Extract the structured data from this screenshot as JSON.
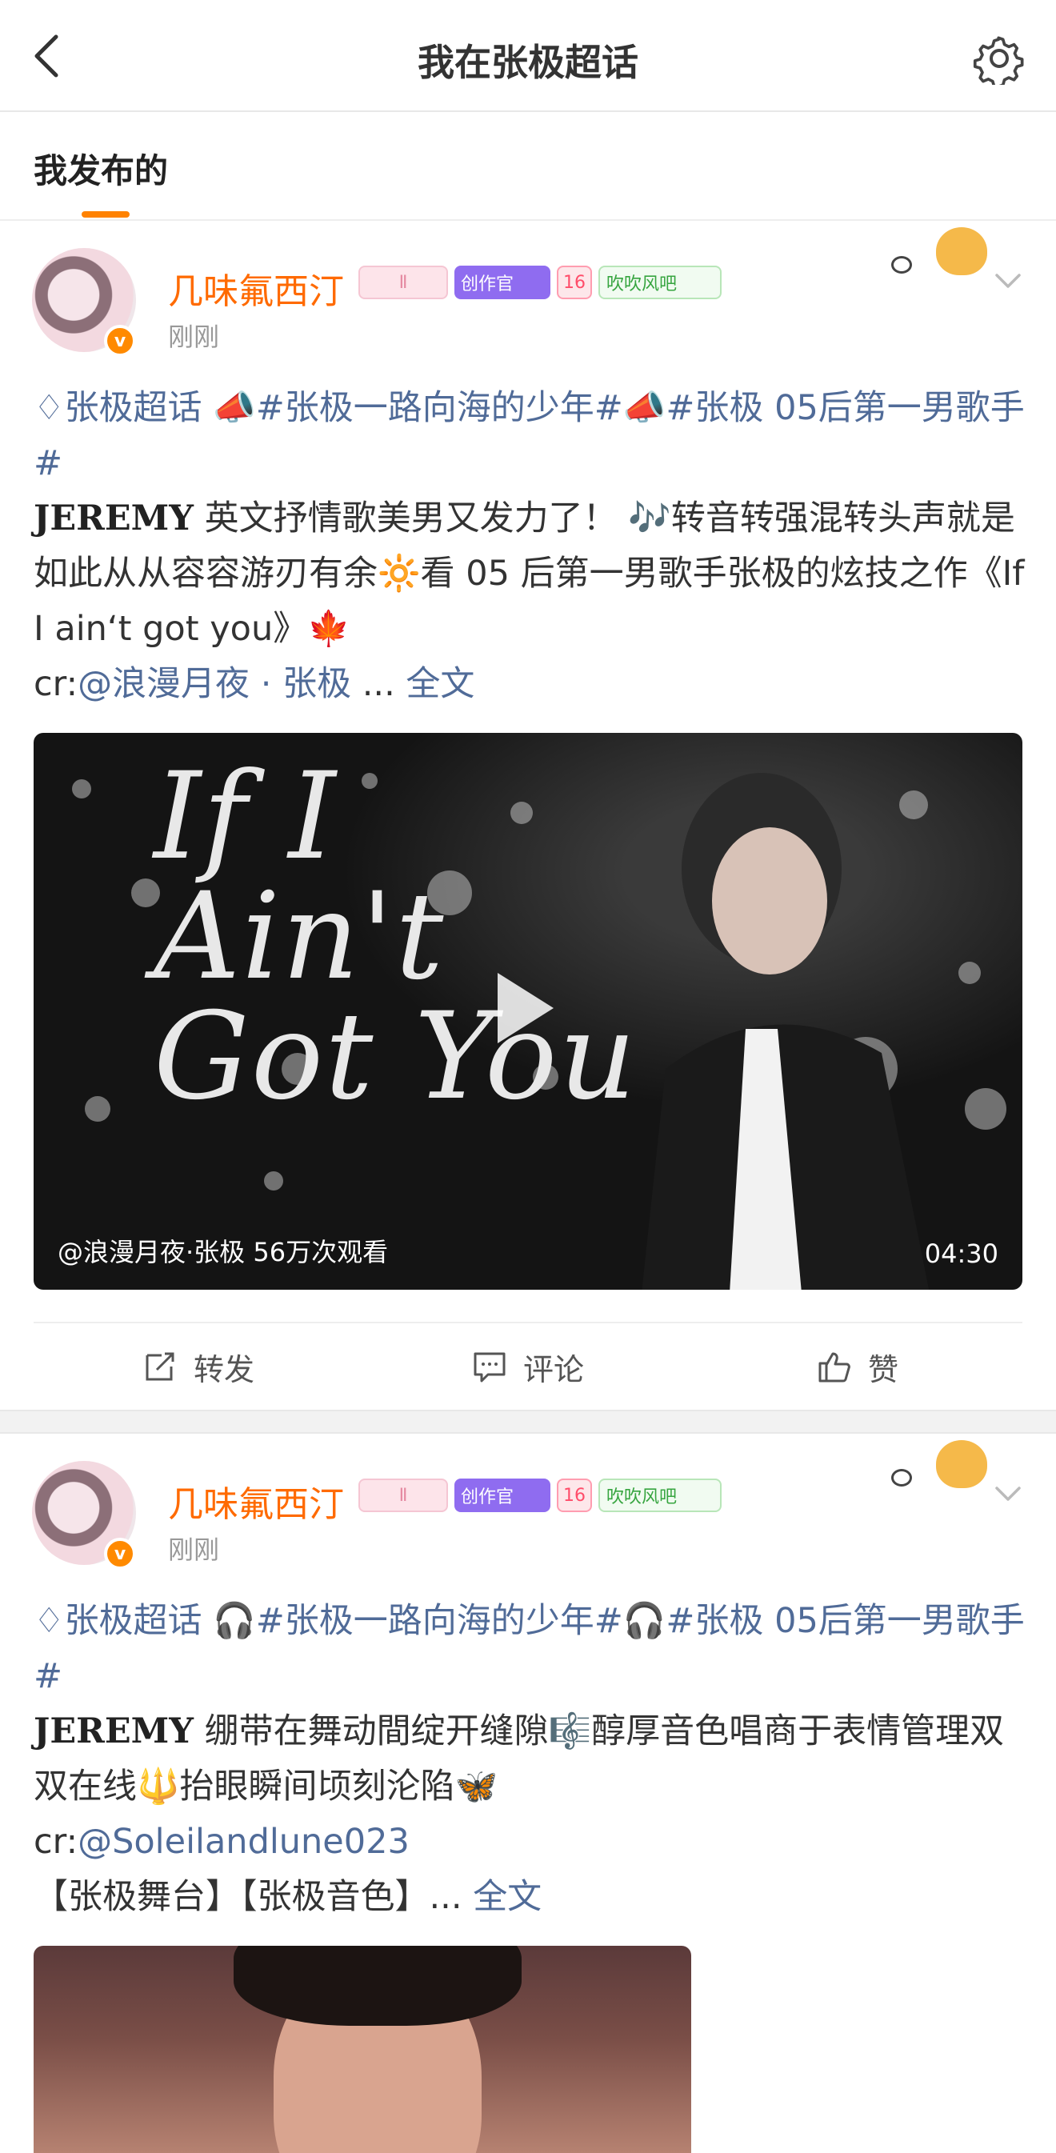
{
  "header": {
    "title": "我在张极超话"
  },
  "tabs": [
    {
      "label": "我发布的"
    }
  ],
  "posts": [
    {
      "username": "几味氟西汀",
      "time": "刚刚",
      "badges": {
        "level": "Ⅱ",
        "creator": "创作官",
        "fan": "16",
        "club": "吹吹风吧"
      },
      "text": {
        "topic": "张极超话",
        "emoji1": "📣",
        "tag1": "#张极一路向海的少年#",
        "emoji2": "📣",
        "tag2": "#张极 05后第一男歌手#",
        "bold": "JEREMY",
        "body": " 英文抒情歌美男又发力了！",
        "emoji3": "🎶",
        "body2": "转音转强混转头声就是如此从从容容游刃有余",
        "emoji4": "🔆",
        "body3": "看 05 后第一男歌手张极的炫技之作《If I ain‘t got you》",
        "emoji5": "🍁",
        "cr_label": "cr:",
        "mention": "@浪漫月夜 · 张极",
        "ellipsis": " ... ",
        "more": "全文"
      },
      "video": {
        "title_art": "If I\nAin't\nGot You",
        "caption": "@浪漫月夜·张极 56万次观看",
        "duration": "04:30"
      },
      "actions": {
        "repost": "转发",
        "comment": "评论",
        "like": "赞"
      }
    },
    {
      "username": "几味氟西汀",
      "time": "刚刚",
      "badges": {
        "level": "Ⅱ",
        "creator": "创作官",
        "fan": "16",
        "club": "吹吹风吧"
      },
      "text": {
        "topic": "张极超话",
        "emoji1": "🎧",
        "tag1": "#张极一路向海的少年#",
        "emoji2": "🎧",
        "tag2": "#张极 05后第一男歌手#",
        "bold": "JEREMY",
        "body": " 绷带在舞动間绽开缝隙",
        "emoji3": "🎼",
        "body2": "醇厚音色唱商于表情管理双双在线",
        "emoji4": "🔱",
        "body3": "抬眼瞬间顷刻沦陷",
        "emoji5": "🦋",
        "cr_label": "cr:",
        "mention": "@Soleilandlune023",
        "tags_line": "【张极舞台】【张极音色】",
        "ellipsis": "... ",
        "more": "全文"
      }
    }
  ]
}
